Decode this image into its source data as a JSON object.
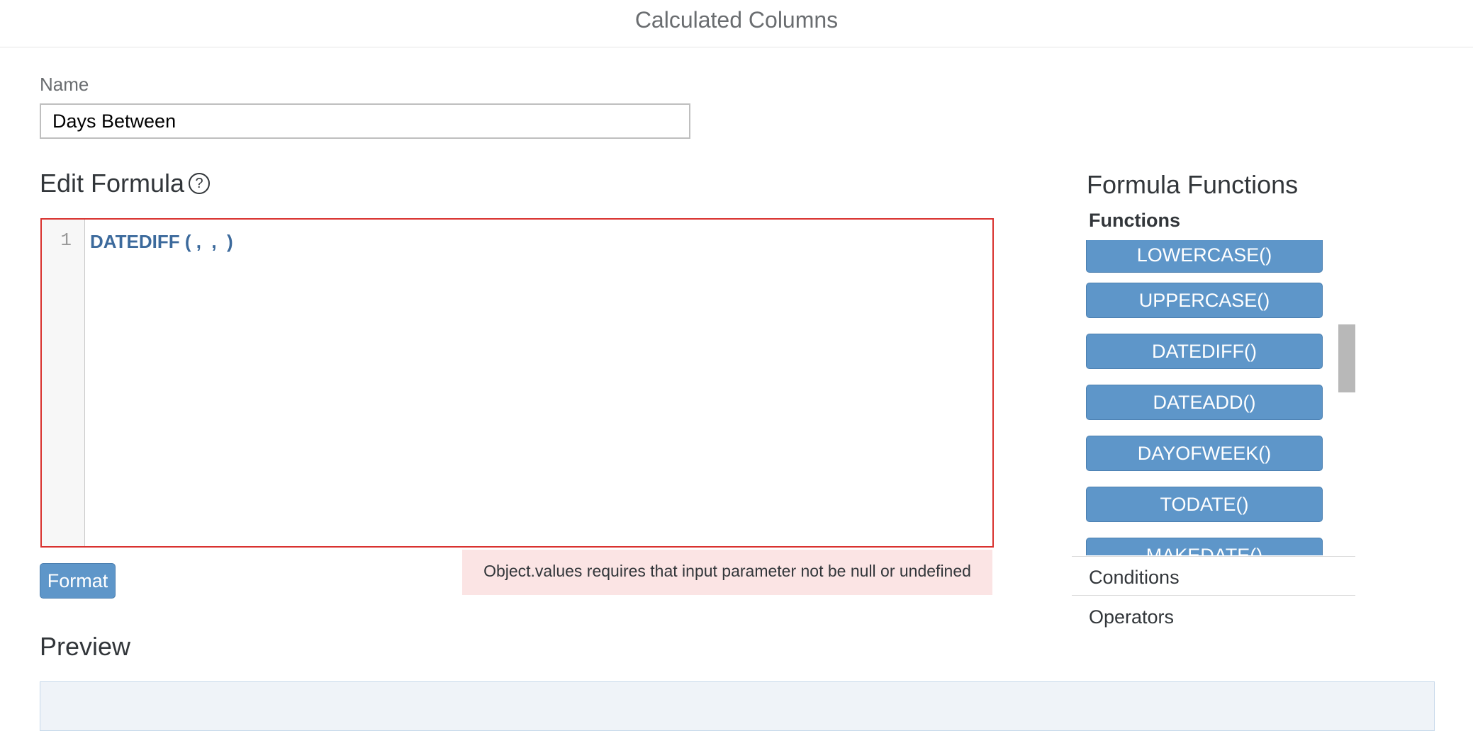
{
  "header": {
    "title": "Calculated Columns"
  },
  "name_field": {
    "label": "Name",
    "value": "Days Between"
  },
  "editor": {
    "title": "Edit Formula",
    "help_icon": "question-circle-icon",
    "line_number": "1",
    "code": "DATEDIFF ( ,  ,  )",
    "error_border_color": "#d9322f"
  },
  "format_button": {
    "label": "Format"
  },
  "error": {
    "message": "Object.values requires that input parameter not be null or undefined"
  },
  "preview": {
    "title": "Preview"
  },
  "formula_functions": {
    "title": "Formula Functions",
    "functions_label": "Functions",
    "items": [
      "LOWERCASE()",
      "UPPERCASE()",
      "DATEDIFF()",
      "DATEADD()",
      "DAYOFWEEK()",
      "TODATE()",
      "MAKEDATE()"
    ],
    "sections": [
      "Conditions",
      "Operators"
    ]
  },
  "colors": {
    "accent": "#5e96c9",
    "error_bg": "#fbe4e4",
    "preview_bg": "#eff3f8",
    "code_keyword": "#3c6a9c"
  }
}
